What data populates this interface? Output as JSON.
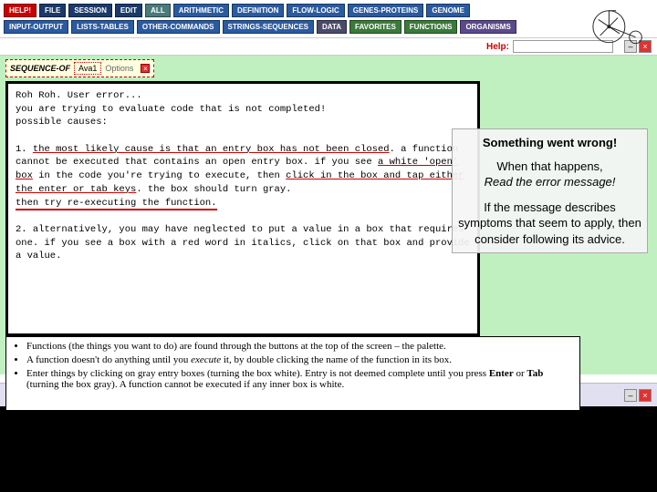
{
  "menubar": {
    "row1": [
      {
        "label": "HELP!",
        "cls": "m-red"
      },
      {
        "label": "FILE",
        "cls": "m-navy"
      },
      {
        "label": "SESSION",
        "cls": "m-navy"
      },
      {
        "label": "EDIT",
        "cls": "m-navy"
      },
      {
        "label": "ALL",
        "cls": "m-teal"
      },
      {
        "label": "ARITHMETIC",
        "cls": "m-blue"
      },
      {
        "label": "DEFINITION",
        "cls": "m-blue"
      },
      {
        "label": "FLOW-LOGIC",
        "cls": "m-blue"
      },
      {
        "label": "GENES-PROTEINS",
        "cls": "m-blue"
      },
      {
        "label": "GENOME",
        "cls": "m-blue"
      }
    ],
    "row2": [
      {
        "label": "INPUT-OUTPUT",
        "cls": "m-blue"
      },
      {
        "label": "LISTS-TABLES",
        "cls": "m-blue"
      },
      {
        "label": "OTHER-COMMANDS",
        "cls": "m-blue"
      },
      {
        "label": "STRINGS-SEQUENCES",
        "cls": "m-blue"
      },
      {
        "label": "DATA",
        "cls": "m-gray"
      },
      {
        "label": "FAVORITES",
        "cls": "m-green"
      },
      {
        "label": "FUNCTIONS",
        "cls": "m-green"
      },
      {
        "label": "ORGANISMS",
        "cls": "m-purple"
      }
    ]
  },
  "helpbar": {
    "label": "Help:",
    "placeholder": ""
  },
  "seqbar": {
    "title": "SEQUENCE-OF",
    "box": "Ava1",
    "options": "Options"
  },
  "error": {
    "l1": "Roh Roh.  User error...",
    "l2": "you are trying to evaluate code that is not completed!",
    "l3": "possible causes:",
    "p1a": "1. ",
    "p1b": "the most likely cause is that an entry box has not been closed",
    "p1c": ". a function cannot be executed that contains an open entry box. if you see ",
    "p1d": "a white 'open' box",
    "p1e": " in the code you're trying to execute, then ",
    "p1f": "click in the box and tap either the enter or tab keys",
    "p1g": ". the box should turn gray.",
    "p1h": "then try re-executing the function.",
    "p2": "2. alternatively, you may have neglected to put a value in a box that requires one. if you see a box with a red word in italics, click on that box and provide a value."
  },
  "callout": {
    "line1": "Something went wrong!",
    "line2a": "When that happens,",
    "line2b": "Read the error message!",
    "line3": "If the message describes symptoms that seem to apply, then consider following its advice."
  },
  "hints": {
    "h1a": "Functions (the things you want to do) are found through the buttons at the top of the screen – the palette.",
    "h2a": "A function doesn't do anything until you ",
    "h2b": "execute",
    "h2c": " it, by double clicking the name of the function in its box.",
    "h3a": "Enter things by clicking on gray entry boxes (turning the box white). Entry is not deemed complete until you press ",
    "h3b": "Enter",
    "h3c": " or ",
    "h3d": "Tab",
    "h3e": " (turning the box gray). A function cannot be executed if any inner box is white."
  }
}
